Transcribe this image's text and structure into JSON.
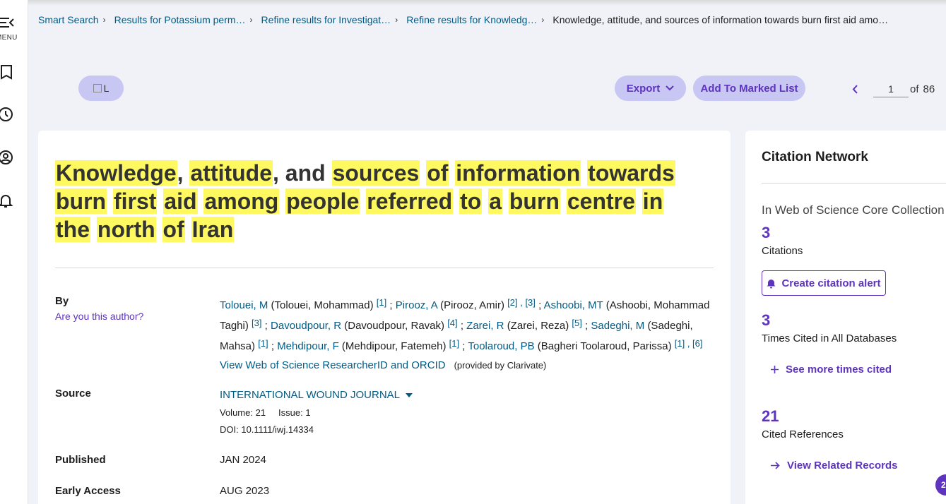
{
  "sidebar": {
    "menu_label": "MENU"
  },
  "breadcrumb": [
    {
      "label": "Smart Search"
    },
    {
      "label": "Results for Potassium perm…"
    },
    {
      "label": "Refine results for Investigat…"
    },
    {
      "label": "Refine results for Knowledg…"
    },
    {
      "label": "Knowledge, attitude, and sources of information towards burn first aid amo…"
    }
  ],
  "toolbar": {
    "logo_alt": "L",
    "export_label": "Export",
    "marked_list_label": "Add To Marked List",
    "page_current": "1",
    "page_of": "of",
    "page_total": "86"
  },
  "record": {
    "title_words": [
      "Knowledge",
      ", ",
      "attitude",
      ", and ",
      "sources",
      " ",
      "of",
      " ",
      "information",
      " ",
      "towards",
      " ",
      "burn",
      " ",
      "first",
      " ",
      "aid",
      " ",
      "among",
      " ",
      "people",
      " ",
      "referred",
      " ",
      "to",
      " ",
      "a",
      " ",
      "burn",
      " ",
      "centre",
      " ",
      "in",
      " ",
      "the",
      " ",
      "north",
      " ",
      "of",
      " ",
      "Iran"
    ],
    "by_label": "By",
    "author_question": "Are you this author?",
    "authors": [
      {
        "short": "Tolouei, M",
        "full": "(Tolouei, Mohammad)",
        "refs": "[1]"
      },
      {
        "short": "Pirooz, A",
        "full": "(Pirooz, Amir)",
        "refs": "[2] , [3]"
      },
      {
        "short": "Ashoobi, MT",
        "full": "(Ashoobi, Mohammad Taghi)",
        "refs": "[3]"
      },
      {
        "short": "Davoudpour, R",
        "full": "(Davoudpour, Ravak)",
        "refs": "[4]"
      },
      {
        "short": "Zarei, R",
        "full": "(Zarei, Reza)",
        "refs": "[5]"
      },
      {
        "short": "Sadeghi, M",
        "full": "(Sadeghi, Mahsa)",
        "refs": "[1]"
      },
      {
        "short": "Mehdipour, F",
        "full": "(Mehdipour, Fatemeh)",
        "refs": "[1]"
      },
      {
        "short": "Toolaroud, PB",
        "full": "(Bagheri Toolaroud, Parissa)",
        "refs": "[1] , [6]"
      }
    ],
    "researcher_link": "View Web of Science ResearcherID and ORCID",
    "provided_by": "(provided by Clarivate)",
    "source_label": "Source",
    "journal": "INTERNATIONAL WOUND JOURNAL",
    "volume": "Volume: 21",
    "issue": "Issue: 1",
    "doi": "DOI: 10.1111/iwj.14334",
    "published_label": "Published",
    "published_value": "JAN 2024",
    "early_access_label": "Early Access",
    "early_access_value": "AUG 2023"
  },
  "citation_network": {
    "title": "Citation Network",
    "collection": "In Web of Science Core Collection",
    "citations_count": "3",
    "citations_label": "Citations",
    "alert_label": "Create citation alert",
    "times_cited_count": "3",
    "times_cited_label": "Times Cited in All Databases",
    "see_more_label": "See more times cited",
    "cited_refs_count": "21",
    "cited_refs_label": "Cited References",
    "related_label": "View Related Records"
  },
  "help_badge": "2",
  "colors": {
    "accent": "#5e33bf",
    "link": "#005a84",
    "highlight": "#fff961",
    "pill": "#c8c6f2"
  }
}
